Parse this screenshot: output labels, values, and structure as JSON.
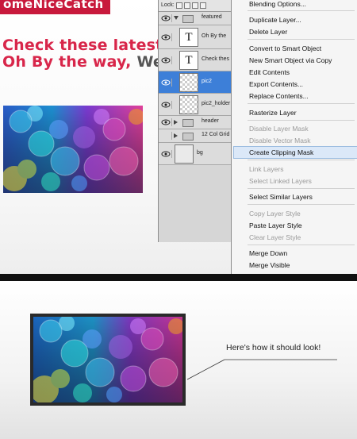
{
  "canvas": {
    "logo_text": "omeNiceCatch",
    "headline_line1": "Check these latest",
    "headline_line2_colored": "Oh By the way,",
    "headline_line2_gray": "We"
  },
  "layers_panel": {
    "lock_label": "Lock:",
    "layers": [
      {
        "name": "featured",
        "kind": "group",
        "expanded": true,
        "visible": true
      },
      {
        "name": "Oh By the",
        "kind": "text",
        "visible": true
      },
      {
        "name": "Check thes",
        "kind": "text",
        "visible": true
      },
      {
        "name": "pic2",
        "kind": "image",
        "selected": true,
        "visible": true
      },
      {
        "name": "pic2_holder",
        "kind": "image",
        "visible": true
      },
      {
        "name": "header",
        "kind": "group",
        "expanded": false,
        "visible": true
      },
      {
        "name": "12 Col Grid",
        "kind": "group",
        "expanded": false,
        "visible": false
      },
      {
        "name": "bg",
        "kind": "fill",
        "visible": true
      }
    ]
  },
  "context_menu": {
    "items": [
      {
        "label": "Blending Options...",
        "enabled": true
      },
      {
        "label": "Duplicate Layer...",
        "enabled": true
      },
      {
        "label": "Delete Layer",
        "enabled": true
      },
      {
        "label": "Convert to Smart Object",
        "enabled": true
      },
      {
        "label": "New Smart Object via Copy",
        "enabled": true
      },
      {
        "label": "Edit Contents",
        "enabled": true
      },
      {
        "label": "Export Contents...",
        "enabled": true
      },
      {
        "label": "Replace Contents...",
        "enabled": true
      },
      {
        "label": "Rasterize Layer",
        "enabled": true
      },
      {
        "label": "Disable Layer Mask",
        "enabled": false
      },
      {
        "label": "Disable Vector Mask",
        "enabled": false
      },
      {
        "label": "Create Clipping Mask",
        "enabled": true,
        "highlighted": true
      },
      {
        "label": "Link Layers",
        "enabled": false
      },
      {
        "label": "Select Linked Layers",
        "enabled": false
      },
      {
        "label": "Select Similar Layers",
        "enabled": true
      },
      {
        "label": "Copy Layer Style",
        "enabled": false
      },
      {
        "label": "Paste Layer Style",
        "enabled": true
      },
      {
        "label": "Clear Layer Style",
        "enabled": false
      },
      {
        "label": "Merge Down",
        "enabled": true
      },
      {
        "label": "Merge Visible",
        "enabled": true
      }
    ]
  },
  "result": {
    "caption": "Here's how it should look!"
  },
  "colors": {
    "brand_red": "#d8264a",
    "selection_blue": "#3d7fd8",
    "menu_highlight": "#dbe8f8"
  }
}
